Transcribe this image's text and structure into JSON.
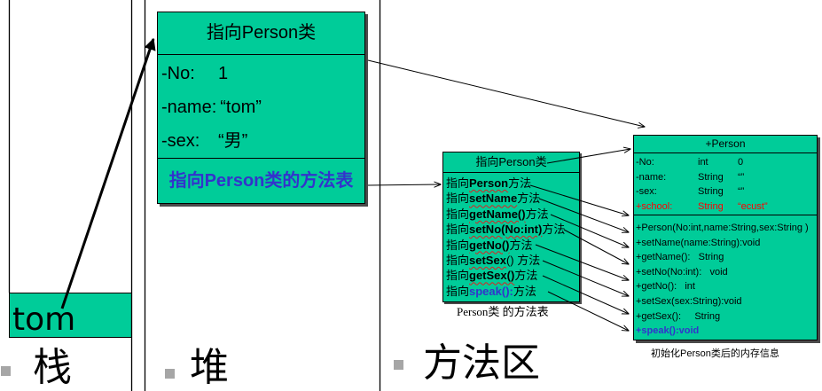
{
  "stack": {
    "label": "栈",
    "variable": "tom"
  },
  "heap": {
    "label": "堆",
    "object": {
      "header": "指向Person类",
      "fields": [
        {
          "name": "-No:",
          "value": "1"
        },
        {
          "name": "-name:",
          "value": "“tom”"
        },
        {
          "name": "-sex:",
          "value": "“男”"
        }
      ],
      "method_table_ref": "指向Person类的方法表"
    }
  },
  "method_area": {
    "label": "方法区",
    "method_table": {
      "header": "指向Person类",
      "rows": [
        {
          "prefix": "指向",
          "method": "Person",
          "suffix": "方法"
        },
        {
          "prefix": "指向",
          "method": "setName",
          "suffix": "方法"
        },
        {
          "prefix": "指向",
          "method": "getName()",
          "suffix": "方法"
        },
        {
          "prefix": "指向",
          "method": "setNo(No:int)",
          "suffix": "方法"
        },
        {
          "prefix": "指向",
          "method": "getNo()",
          "suffix": "方法"
        },
        {
          "prefix": "指向",
          "method": "setSex",
          "suffix": "() 方法"
        },
        {
          "prefix": "指向",
          "method": "getSex()",
          "suffix": "方法"
        },
        {
          "prefix": "指向",
          "method": "speak():",
          "suffix": "方法"
        }
      ],
      "caption": "Person类 的方法表"
    },
    "class_info": {
      "title": "+Person",
      "fields": [
        {
          "name": "-No:",
          "type": "int",
          "value": "0"
        },
        {
          "name": "-name:",
          "type": "String",
          "value": "“”"
        },
        {
          "name": "-sex:",
          "type": "String",
          "value": "“”"
        },
        {
          "name": "+school:",
          "type": "String",
          "value": "“ecust”"
        }
      ],
      "methods": [
        "+Person(No:int,name:String,sex:String )",
        "+setName(name:String):void",
        "+getName():   String",
        "+setNo(No:int):   void",
        "+getNo():   int",
        "+setSex(sex:String):void",
        "+getSex():     String",
        "+speak():void"
      ],
      "caption": "初始化Person类后的内存信息"
    }
  },
  "colors": {
    "object_fill": "#00CC99",
    "pointer_text": "#3333CC",
    "added_field": "#FF0000",
    "bullet": "#A6A6A6"
  }
}
